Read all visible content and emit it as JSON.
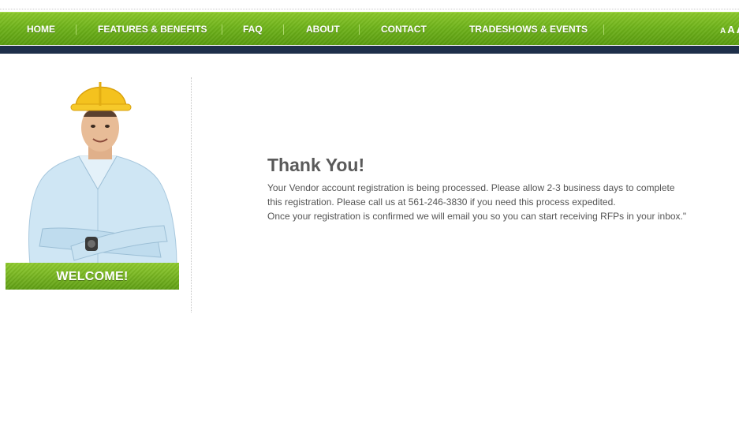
{
  "nav": {
    "items": [
      {
        "label": "HOME"
      },
      {
        "label": "FEATURES & BENEFITS"
      },
      {
        "label": "FAQ"
      },
      {
        "label": "ABOUT"
      },
      {
        "label": "CONTACT"
      },
      {
        "label": "TRADESHOWS & EVENTS"
      }
    ],
    "font_size": {
      "small": "A",
      "medium": "A",
      "large": "A"
    }
  },
  "sidebar": {
    "welcome_label": "WELCOME!"
  },
  "main": {
    "title": "Thank You!",
    "lines": [
      "Your Vendor account registration is being processed. Please allow 2-3 business days to complete",
      "this registration. Please call us at 561-246-3830 if you need this process expedited.",
      "Once your registration is confirmed we will email you so you can start receiving RFPs in your inbox.\""
    ]
  },
  "colors": {
    "nav_green": "#6fb31b",
    "navy": "#1e2f4a",
    "title_gray": "#5a5a5a",
    "text_gray": "#555555"
  }
}
